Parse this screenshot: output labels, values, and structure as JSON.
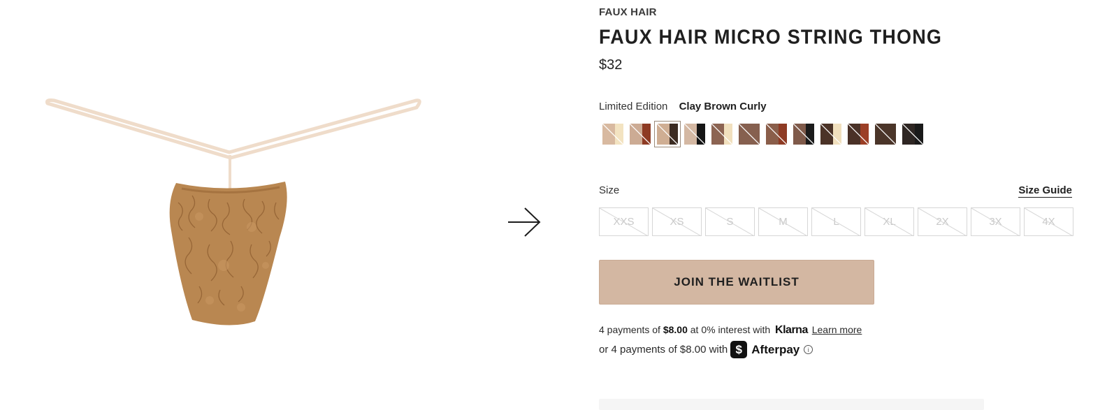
{
  "product": {
    "brand": "FAUX HAIR",
    "title": "FAUX HAIR MICRO STRING THONG",
    "price": "$32"
  },
  "color": {
    "label": "Limited Edition",
    "selected_name": "Clay Brown Curly",
    "selected_index": 2,
    "swatches": [
      {
        "left": "#d8b9a0",
        "right": "#f3e3c1"
      },
      {
        "left": "#ccab94",
        "right": "#8e3b24"
      },
      {
        "left": "#cfae93",
        "right": "#3b2b22"
      },
      {
        "left": "#d4b8a3",
        "right": "#151515"
      },
      {
        "left": "#8c6452",
        "right": "#f1e0be"
      },
      {
        "left": "#86604f",
        "right": "#86604f"
      },
      {
        "left": "#8a5e4a",
        "right": "#8e3b24"
      },
      {
        "left": "#7f5a4a",
        "right": "#1b1b1b"
      },
      {
        "left": "#4b3327",
        "right": "#f1e0be"
      },
      {
        "left": "#4a3127",
        "right": "#9c3f26"
      },
      {
        "left": "#4b3529",
        "right": "#4b3529"
      },
      {
        "left": "#2e2623",
        "right": "#1a1a1a"
      }
    ]
  },
  "size": {
    "label": "Size",
    "guide_label": "Size Guide",
    "options": [
      "XXS",
      "XS",
      "S",
      "M",
      "L",
      "XL",
      "2X",
      "3X",
      "4X"
    ]
  },
  "cta": {
    "waitlist_label": "JOIN THE WAITLIST"
  },
  "klarna": {
    "prefix": "4 payments of",
    "amount": "$8.00",
    "suffix": "at 0% interest with",
    "brand": "Klarna",
    "learn_more": "Learn more"
  },
  "afterpay": {
    "text": "or 4 payments of $8.00 with",
    "icon_glyph": "$",
    "brand": "Afterpay",
    "info_glyph": "i"
  },
  "icons": {
    "next_arrow": "arrow-right-icon"
  }
}
